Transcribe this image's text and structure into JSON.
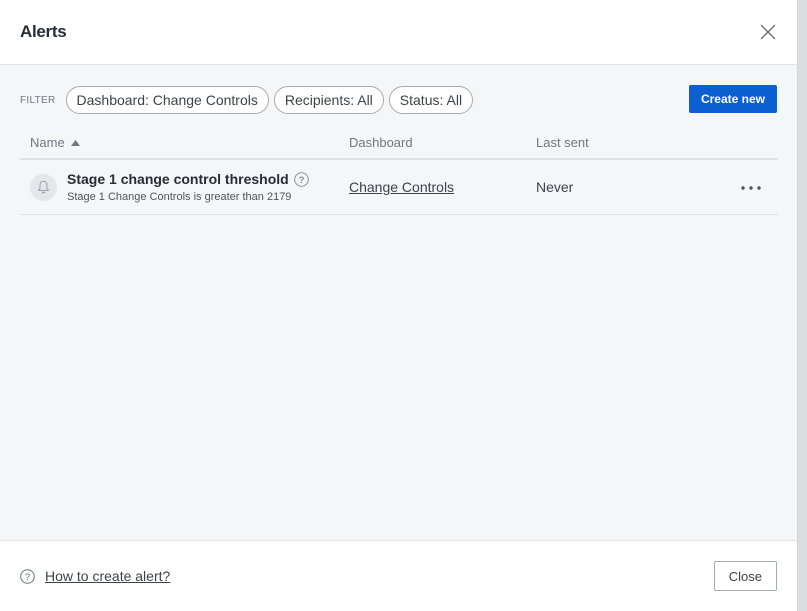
{
  "modal": {
    "title": "Alerts"
  },
  "filter": {
    "label": "FILTER",
    "pills": [
      "Dashboard: Change Controls",
      "Recipients: All",
      "Status: All"
    ],
    "create_label": "Create new"
  },
  "table": {
    "columns": {
      "name": "Name",
      "dashboard": "Dashboard",
      "last_sent": "Last sent"
    },
    "rows": [
      {
        "name": "Stage 1 change control threshold",
        "description": "Stage 1 Change Controls is greater than 2179",
        "dashboard": "Change Controls",
        "last_sent": "Never"
      }
    ]
  },
  "footer": {
    "help_link": "How to create alert?",
    "close_label": "Close"
  },
  "colors": {
    "primary_button": "#0b5fd1",
    "body_background": "#f5f6f7",
    "text": "#262d33"
  },
  "icons": [
    "close-icon",
    "sort-ascending-icon",
    "bell-icon",
    "help-circle-icon",
    "more-options-icon"
  ]
}
